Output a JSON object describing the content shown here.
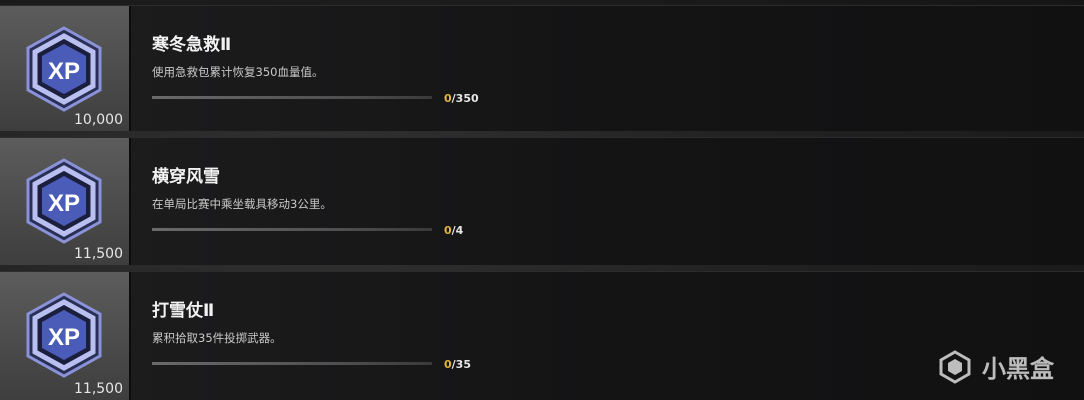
{
  "challenges": [
    {
      "title": "寒冬急救Ⅱ",
      "description": "使用急救包累计恢复350血量值。",
      "reward_xp": "10,000",
      "progress_current": "0",
      "progress_total": "/350",
      "progress_fraction": 0
    },
    {
      "title": "横穿风雪",
      "description": "在单局比赛中乘坐载具移动3公里。",
      "reward_xp": "11,500",
      "progress_current": "0",
      "progress_total": "/4",
      "progress_fraction": 0
    },
    {
      "title": "打雪仗Ⅱ",
      "description": "累积拾取35件投掷武器。",
      "reward_xp": "11,500",
      "progress_current": "0",
      "progress_total": "/35",
      "progress_fraction": 0
    }
  ],
  "icons": {
    "reward": "xp-badge-icon",
    "brand": "xiaoheihe-logo-icon"
  },
  "xp_label": "XP",
  "watermark": {
    "text": "小黑盒"
  },
  "colors": {
    "progress_current": "#e0b53c",
    "badge_blue": "#4a5bb8"
  }
}
